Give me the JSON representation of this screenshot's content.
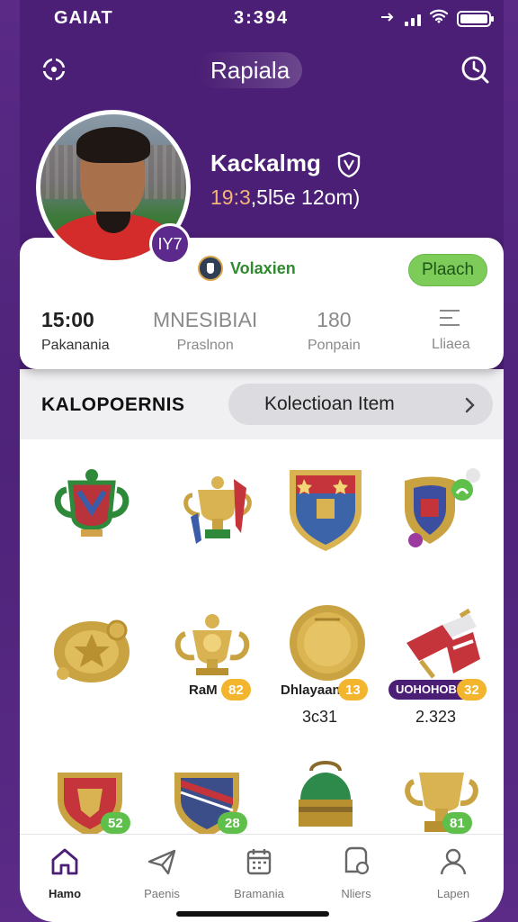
{
  "status_bar": {
    "carrier": "GAIAT",
    "time": "3:394"
  },
  "header": {
    "title": "Rapiala",
    "left_icon": "target-icon",
    "right_icon": "clock-icon"
  },
  "profile": {
    "avatar_badge": "IY7",
    "name": "Kackalmg",
    "subtitle_accent": "19:3",
    "subtitle_rest": ",5l5e 12om)",
    "team_name": "Volaxien",
    "follow_label": "Plaach"
  },
  "stats": [
    {
      "value": "15:00",
      "label": "Pakanania"
    },
    {
      "value": "MNESIBIAI",
      "label": "Praslnon"
    },
    {
      "value": "180",
      "label": "Ponpain"
    },
    {
      "value": "",
      "label": "Lliaea"
    }
  ],
  "section": {
    "title": "KALOPOERNIS",
    "collection_button": "Kolectioan Item"
  },
  "items_row2": {
    "item2_label": "RaM",
    "item2_badge": "82",
    "item3_label": "Dhlayaan",
    "item3_badge": "13",
    "item3_count": "3c31",
    "item4_label": "UOHOHOBK",
    "item4_badge": "32",
    "item4_count": "2.323"
  },
  "items_row3": {
    "item1_badge": "52",
    "item2_badge": "28",
    "item4_badge": "81"
  },
  "tabs": [
    {
      "label": "Hamo",
      "icon": "home-icon"
    },
    {
      "label": "Paenis",
      "icon": "paper-plane-icon"
    },
    {
      "label": "Bramania",
      "icon": "calendar-icon"
    },
    {
      "label": "Nliers",
      "icon": "badge-icon"
    },
    {
      "label": "Lapen",
      "icon": "user-icon"
    }
  ]
}
